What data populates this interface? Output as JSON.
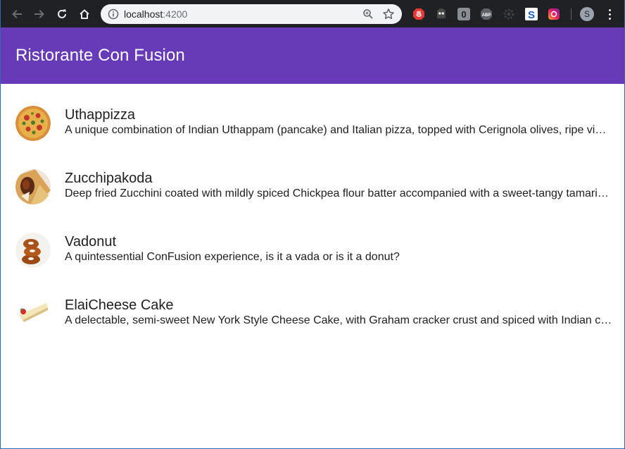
{
  "browser": {
    "url_host": "localhost",
    "url_port": ":4200",
    "profile_initial": "S",
    "extensions": [
      "adblock-icon",
      "ghostery-icon",
      "extension-zero-icon",
      "abp-icon",
      "settings-extension-icon",
      "stylish-icon",
      "instagram-extension-icon"
    ]
  },
  "app": {
    "title": "Ristorante Con Fusion",
    "accent_color": "#673ab7"
  },
  "dishes": [
    {
      "name": "Uthappizza",
      "description": "A unique combination of Indian Uthappam (pancake) and Italian pizza, topped with Cerignola olives, ripe vine cherry tomatoes, Vidalia onion, Guntur chillies and Buffalo Paneer."
    },
    {
      "name": "Zucchipakoda",
      "description": "Deep fried Zucchini coated with mildly spiced Chickpea flour batter accompanied with a sweet-tangy tamarind sauce"
    },
    {
      "name": "Vadonut",
      "description": "A quintessential ConFusion experience, is it a vada or is it a donut?"
    },
    {
      "name": "ElaiCheese Cake",
      "description": "A delectable, semi-sweet New York Style Cheese Cake, with Graham cracker crust and spiced with Indian cardamoms"
    }
  ]
}
